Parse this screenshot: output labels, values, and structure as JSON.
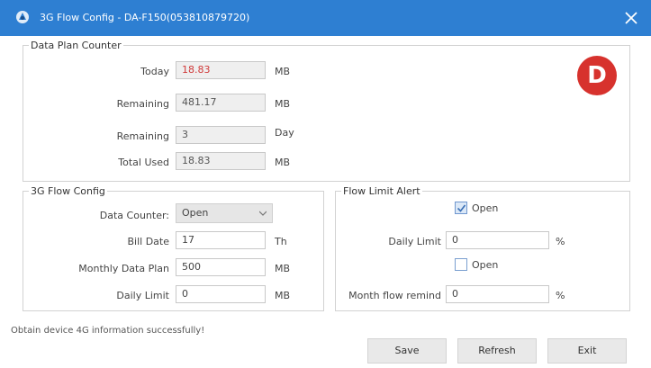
{
  "window": {
    "title": "3G Flow Config - DA-F150(053810879720)",
    "close_icon": "close-icon",
    "app_icon": "app-icon"
  },
  "badge": {
    "letter": "D",
    "color": "#d7322d"
  },
  "colors": {
    "titlebar": "#2e7fd2",
    "highlight_value": "#d03a3a"
  },
  "data_plan_counter": {
    "legend": "Data Plan Counter",
    "today": {
      "label": "Today",
      "value": "18.83",
      "unit": "MB"
    },
    "remaining_mb": {
      "label": "Remaining",
      "value": "481.17",
      "unit": "MB"
    },
    "remaining_day": {
      "label": "Remaining",
      "value": "3",
      "unit": "Day"
    },
    "total_used": {
      "label": "Total Used",
      "value": "18.83",
      "unit": "MB"
    }
  },
  "flow_config": {
    "legend": "3G Flow Config",
    "data_counter": {
      "label": "Data Counter:",
      "value": "Open"
    },
    "bill_date": {
      "label": "Bill Date",
      "value": "17",
      "unit": "Th"
    },
    "monthly_plan": {
      "label": "Monthly Data Plan",
      "value": "500",
      "unit": "MB"
    },
    "daily_limit": {
      "label": "Daily Limit",
      "value": "0",
      "unit": "MB"
    }
  },
  "flow_limit_alert": {
    "legend": "Flow Limit Alert",
    "open1": {
      "label": "Open",
      "checked": true
    },
    "daily_limit": {
      "label": "Daily Limit",
      "value": "0",
      "unit": "%"
    },
    "open2": {
      "label": "Open",
      "checked": false
    },
    "month_remind": {
      "label": "Month flow remind",
      "value": "0",
      "unit": "%"
    }
  },
  "status_text": "Obtain device 4G information successfully!",
  "buttons": {
    "save": "Save",
    "refresh": "Refresh",
    "exit": "Exit"
  }
}
